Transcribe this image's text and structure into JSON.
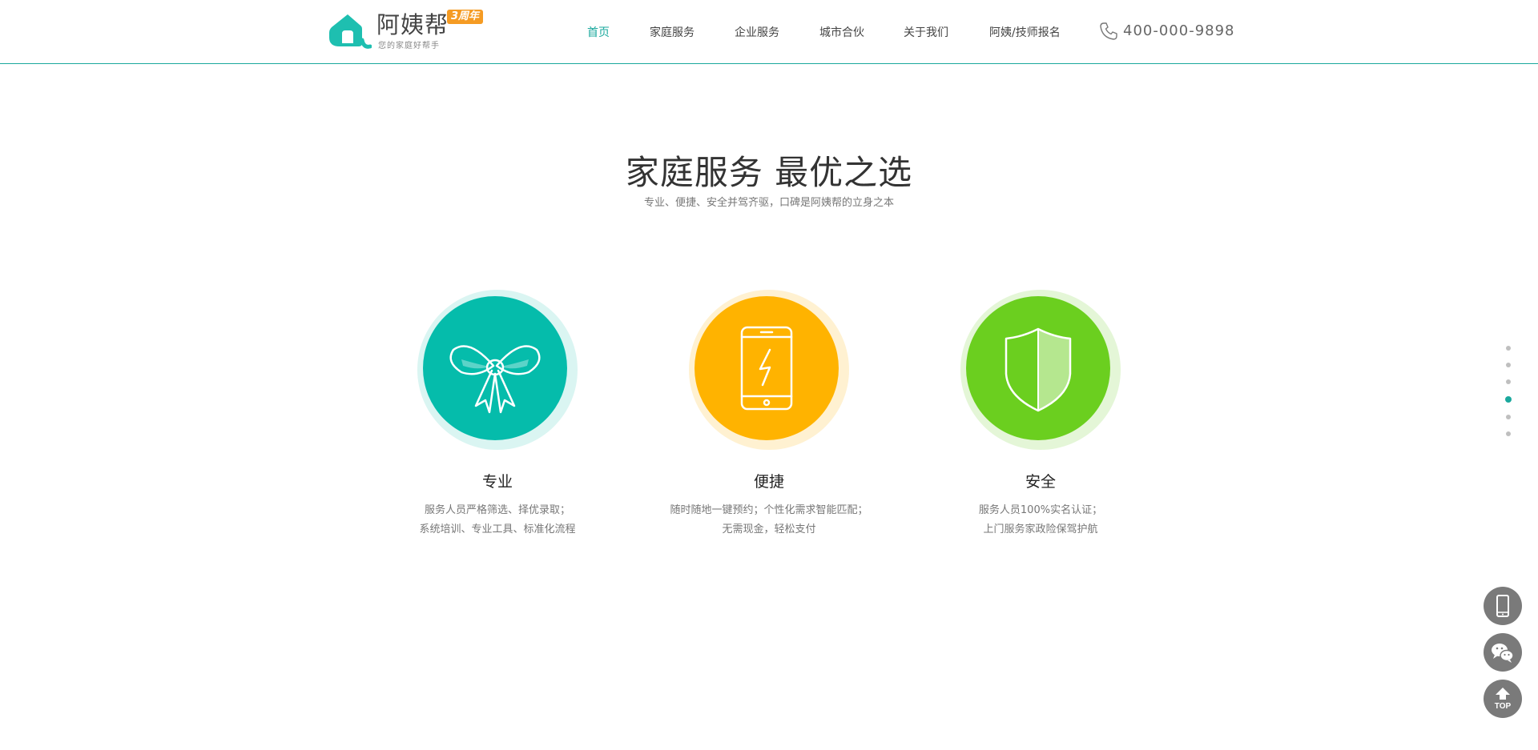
{
  "brand": {
    "name": "阿姨帮",
    "badge": "3周年",
    "tagline": "您的家庭好帮手",
    "accent_color": "#1aa89d"
  },
  "nav": {
    "items": [
      {
        "label": "首页",
        "active": true
      },
      {
        "label": "家庭服务",
        "active": false
      },
      {
        "label": "企业服务",
        "active": false
      },
      {
        "label": "城市合伙",
        "active": false
      },
      {
        "label": "关于我们",
        "active": false
      },
      {
        "label": "阿姨/技师报名",
        "active": false
      }
    ],
    "phone_icon": "phone-icon",
    "phone": "400-000-9898"
  },
  "hero": {
    "title": "家庭服务 最优之选",
    "subtitle": "专业、便捷、安全并驾齐驱，口碑是阿姨帮的立身之本"
  },
  "features": [
    {
      "icon": "bow-icon",
      "color": "#05bcab",
      "title": "专业",
      "lines": [
        "服务人员严格筛选、择优录取；",
        "系统培训、专业工具、标准化流程"
      ]
    },
    {
      "icon": "smartphone-lightning-icon",
      "color": "#ffb300",
      "title": "便捷",
      "lines": [
        "随时随地一键预约；个性化需求智能匹配；",
        "无需现金，轻松支付"
      ]
    },
    {
      "icon": "shield-icon",
      "color": "#6bcf1f",
      "title": "安全",
      "lines": [
        "服务人员100%实名认证；",
        "上门服务家政险保驾护航"
      ]
    }
  ],
  "section_dots": {
    "count": 6,
    "active_index": 3
  },
  "side_buttons": {
    "mobile_icon": "mobile-icon",
    "wechat_icon": "wechat-icon",
    "top_label": "TOP"
  }
}
